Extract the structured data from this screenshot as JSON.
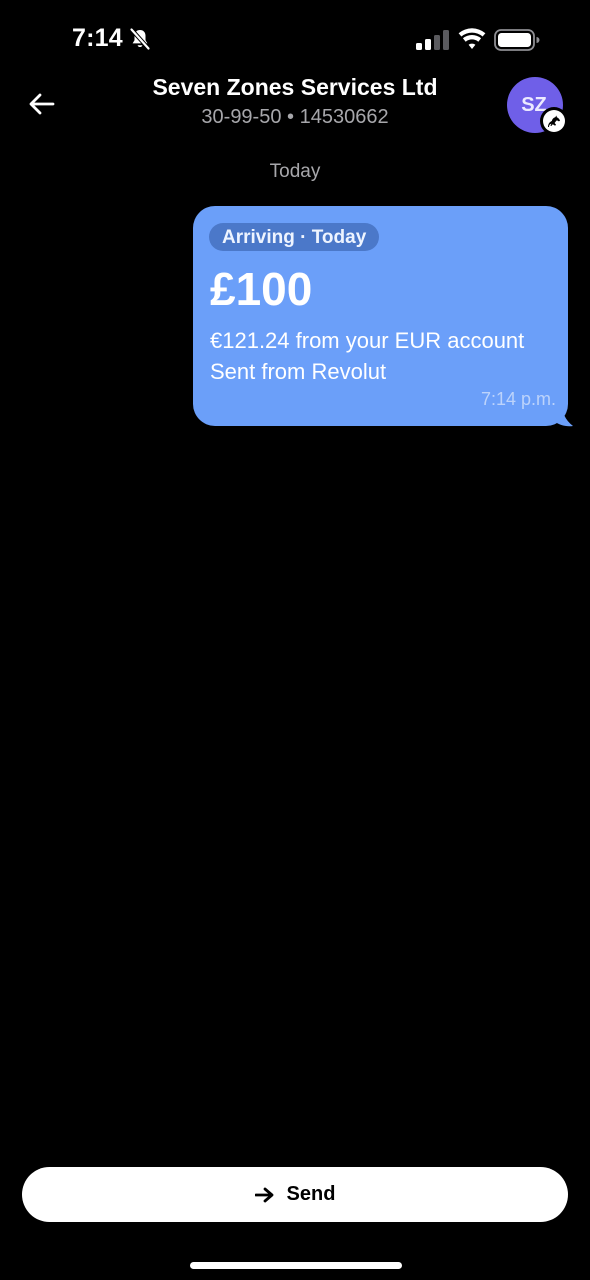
{
  "status_bar": {
    "time": "7:14",
    "icons": [
      "bell-off-icon",
      "signal-icon",
      "wifi-icon",
      "battery-icon"
    ]
  },
  "header": {
    "title": "Seven Zones Services Ltd",
    "subtitle": "30-99-50 • 14530662",
    "avatar_initials": "SZ",
    "back_icon": "arrow-left-icon",
    "badge_icon": "bank-horse-icon"
  },
  "conversation": {
    "date_label": "Today",
    "message": {
      "status": "Arriving · Today",
      "amount": "£100",
      "line1": "€121.24 from your EUR account",
      "line2": "Sent from Revolut",
      "time": "7:14 p.m."
    }
  },
  "footer": {
    "send_label": "Send",
    "send_icon": "arrow-right-icon"
  },
  "colors": {
    "background": "#000000",
    "bubble": "#6b9ff9",
    "status_pill": "#4b78c9",
    "avatar": "#6f5fe8",
    "button": "#ffffff",
    "muted_text": "#a7a7ab"
  }
}
